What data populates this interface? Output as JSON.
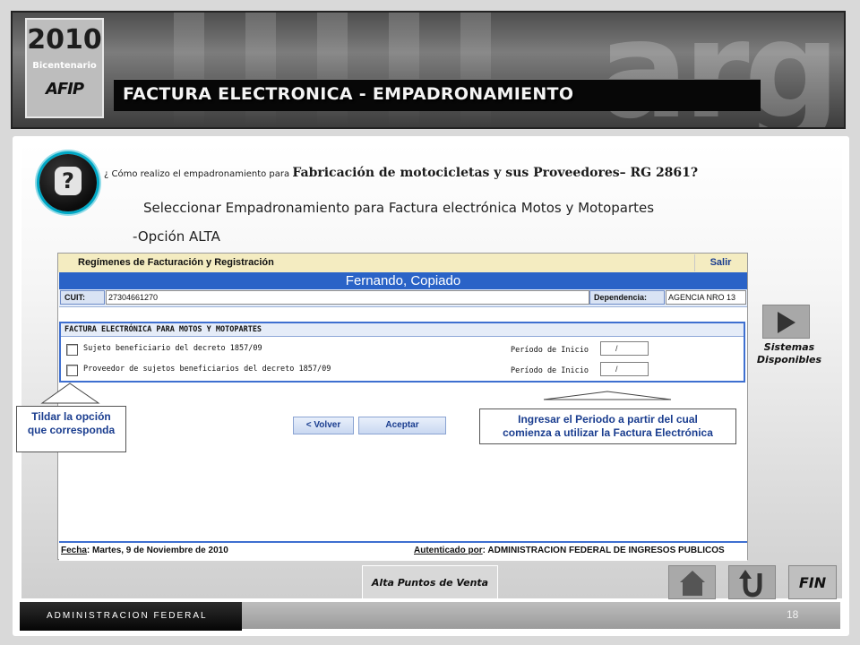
{
  "banner": {
    "logo_year": "2010",
    "logo_sub": "Bicentenario",
    "logo_brand": "AFIP",
    "watermark": "arg",
    "title": "FACTURA ELECTRONICA   - EMPADRONAMIENTO"
  },
  "question": {
    "prefix": "¿ Cómo realizo el empadronamiento para ",
    "bold": "Fabricación de motocicletas y sus Proveedores– RG 2861?"
  },
  "answer_line1": "Seleccionar Empadronamiento para Factura electrónica Motos y Motopartes",
  "answer_line2": "-Opción ALTA",
  "screen": {
    "header_title": "Regímenes de Facturación y Registración",
    "exit_label": "Salir",
    "user_name": "Fernando, Copiado",
    "cuit_label": "CUIT:",
    "cuit_value": "27304661270",
    "dependencia_label": "Dependencia:",
    "dependencia_value": "AGENCIA NRO 13",
    "regime_title": "FACTURA ELECTRÓNICA PARA MOTOS Y MOTOPARTES",
    "options": [
      {
        "label": "Sujeto beneficiario del decreto 1857/09",
        "period_label": "Período de Inicio",
        "period_value": "/"
      },
      {
        "label": "Proveedor de sujetos beneficiarios del decreto 1857/09",
        "period_label": "Período de Inicio",
        "period_value": "/"
      }
    ],
    "back_button": "< Volver",
    "accept_button": "Aceptar",
    "footer_date_label": "Fecha",
    "footer_date_value": ": Martes, 9 de Noviembre de 2010",
    "footer_auth_label": "Autenticado por",
    "footer_auth_value": ": ADMINISTRACION FEDERAL DE INGRESOS PUBLICOS"
  },
  "callouts": {
    "check_hint_1": "Tildar  la opción",
    "check_hint_2": "que corresponda",
    "period_hint_1": "Ingresar el Periodo a partir del cual",
    "period_hint_2": "comienza a utilizar la Factura Electrónica"
  },
  "side": {
    "sistemas_1": "Sistemas",
    "sistemas_2": "Disponibles"
  },
  "bottom": {
    "alta_label": "Alta Puntos de Venta",
    "fin_label": "FIN",
    "admin_label": "ADMINISTRACION FEDERAL",
    "page_number": "18"
  },
  "icons": [
    "question-icon",
    "play-icon",
    "home-icon",
    "back-arrow-icon"
  ]
}
